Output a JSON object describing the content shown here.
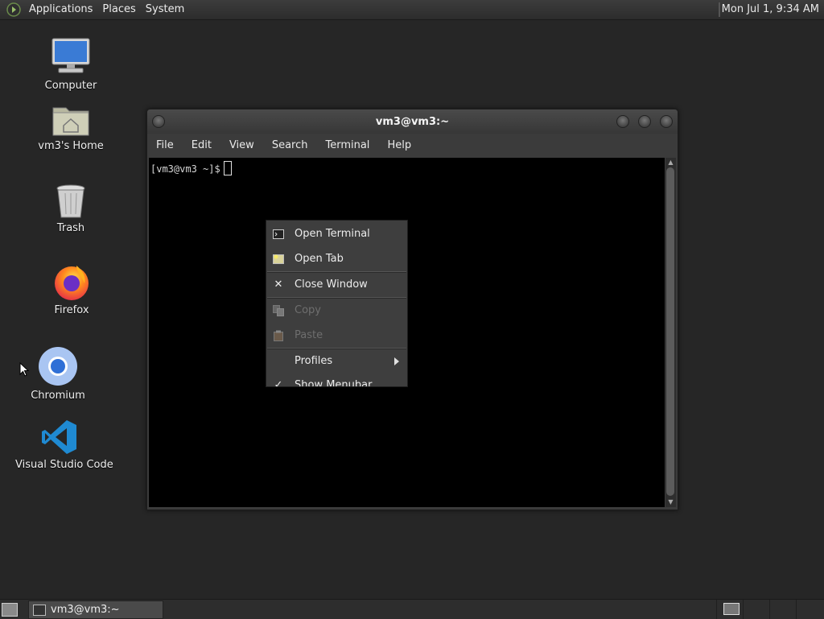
{
  "top_panel": {
    "menus": [
      "Applications",
      "Places",
      "System"
    ],
    "clock": "Mon Jul 1,  9:34 AM"
  },
  "desktop_icons": [
    {
      "label": "Computer",
      "icon": "computer-icon"
    },
    {
      "label": "vm3's Home",
      "icon": "home-folder-icon"
    },
    {
      "label": "Trash",
      "icon": "trash-icon"
    },
    {
      "label": "Firefox",
      "icon": "firefox-icon"
    },
    {
      "label": "Chromium",
      "icon": "chromium-icon"
    },
    {
      "label": "Visual Studio Code",
      "icon": "vscode-icon"
    }
  ],
  "terminal": {
    "title": "vm3@vm3:~",
    "menu": [
      "File",
      "Edit",
      "View",
      "Search",
      "Terminal",
      "Help"
    ],
    "prompt": "[vm3@vm3 ~]$"
  },
  "context_menu": {
    "items": [
      {
        "label": "Open Terminal",
        "icon": "terminal-icon",
        "enabled": true
      },
      {
        "label": "Open Tab",
        "icon": "new-tab-icon",
        "enabled": true
      },
      {
        "label": "Close Window",
        "icon": "close-icon",
        "enabled": true
      },
      {
        "label": "Copy",
        "icon": "copy-icon",
        "enabled": false
      },
      {
        "label": "Paste",
        "icon": "paste-icon",
        "enabled": false
      },
      {
        "label": "Profiles",
        "icon": "",
        "enabled": true,
        "submenu": true
      },
      {
        "label": "Show Menubar",
        "icon": "check-icon",
        "enabled": true,
        "checked": true
      }
    ]
  },
  "taskbar": {
    "window_button": "vm3@vm3:~"
  },
  "colors": {
    "desktop_bg": "#262626",
    "panel_bg": "#2d2d2d",
    "terminal_bg": "#000000",
    "menu_bg": "#3e3e3e"
  }
}
